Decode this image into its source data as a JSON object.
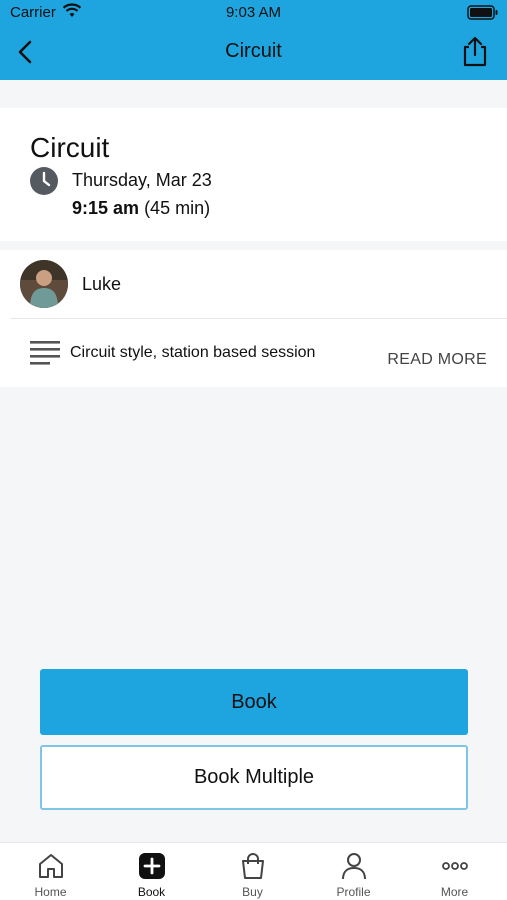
{
  "status_bar": {
    "carrier": "Carrier",
    "time": "9:03 AM"
  },
  "nav": {
    "title": "Circuit",
    "back_icon": "chevron-left-icon",
    "share_icon": "share-icon"
  },
  "class_info": {
    "title": "Circuit",
    "date": "Thursday, Mar 23",
    "start_time": "9:15 am",
    "duration": "(45 min)"
  },
  "instructor": {
    "name": "Luke"
  },
  "description": {
    "text": "Circuit style, station based session",
    "read_more": "READ MORE"
  },
  "actions": {
    "book_label": "Book",
    "book_multiple_label": "Book Multiple"
  },
  "tabbar": {
    "items": [
      {
        "label": "Home",
        "icon": "home-icon"
      },
      {
        "label": "Book",
        "icon": "plus-square-icon"
      },
      {
        "label": "Buy",
        "icon": "shopping-bag-icon"
      },
      {
        "label": "Profile",
        "icon": "person-icon"
      },
      {
        "label": "More",
        "icon": "ellipsis-icon"
      }
    ],
    "active": "Book"
  },
  "colors": {
    "accent": "#1ea5e0",
    "background": "#f5f6f8"
  }
}
